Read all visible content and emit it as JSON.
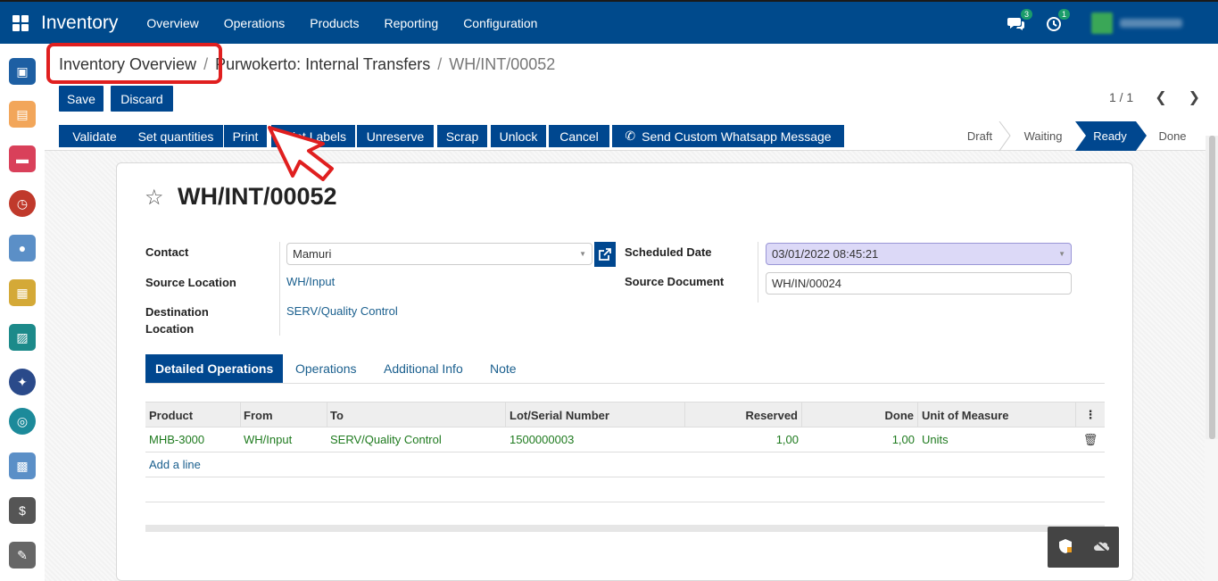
{
  "navbar": {
    "app_title": "Inventory",
    "menu": [
      "Overview",
      "Operations",
      "Products",
      "Reporting",
      "Configuration"
    ],
    "messages_count": "3",
    "activities_count": "1"
  },
  "breadcrumb": {
    "link": "Inventory Overview",
    "sep1": "/",
    "middle": "Purwokerto: Internal Transfers",
    "sep2": "/",
    "current": "WH/INT/00052"
  },
  "buttons": {
    "save": "Save",
    "discard": "Discard"
  },
  "pager": {
    "value": "1 / 1"
  },
  "actions": [
    "Validate",
    "Set quantities",
    "Print",
    "Print Labels",
    "Unreserve",
    "Scrap",
    "Unlock",
    "Cancel",
    "Send Custom Whatsapp Message"
  ],
  "stages": {
    "items": [
      "Draft",
      "Waiting",
      "Ready",
      "Done"
    ],
    "active": "Ready"
  },
  "record": {
    "name": "WH/INT/00052",
    "contact_label": "Contact",
    "contact_value": "Mamuri",
    "source_location_label": "Source Location",
    "source_location_value": "WH/Input",
    "destination_label_line1": "Destination",
    "destination_label_line2": "Location",
    "destination_value": "SERV/Quality Control",
    "scheduled_date_label": "Scheduled Date",
    "scheduled_date_value": "03/01/2022 08:45:21",
    "source_document_label": "Source Document",
    "source_document_value": "WH/IN/00024"
  },
  "tabs": [
    "Detailed Operations",
    "Operations",
    "Additional Info",
    "Note"
  ],
  "table": {
    "headers": [
      "Product",
      "From",
      "To",
      "Lot/Serial Number",
      "Reserved",
      "Done",
      "Unit of Measure"
    ],
    "rows": [
      {
        "product": "MHB-3000",
        "from": "WH/Input",
        "to": "SERV/Quality Control",
        "lot": "1500000003",
        "reserved": "1,00",
        "done": "1,00",
        "uom": "Units"
      }
    ],
    "add_line": "Add a line"
  },
  "colors": {
    "brand": "#004a8c",
    "annotation": "#e01f1f",
    "success_text": "#1e7a1e"
  }
}
